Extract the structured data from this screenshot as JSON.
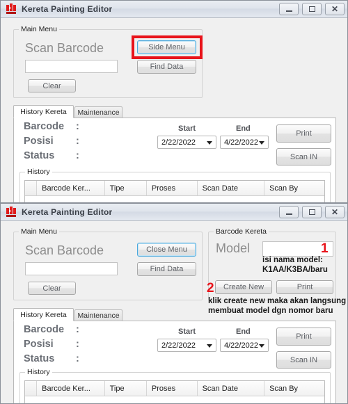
{
  "window": {
    "title": "Kereta Painting Editor",
    "app_icon": "app-icon",
    "controls": {
      "minimize": "minimize-icon",
      "maximize": "maximize-icon",
      "close": "close-icon"
    }
  },
  "main_menu": {
    "legend": "Main Menu",
    "scan_barcode_label": "Scan Barcode",
    "barcode_input_value": "",
    "barcode_input_placeholder": "",
    "clear_button": "Clear",
    "side_menu_button": "Side Menu",
    "close_menu_button": "Close Menu",
    "find_data_button": "Find Data"
  },
  "barcode_kereta": {
    "legend": "Barcode Kereta",
    "model_label": "Model",
    "model_input_value": "",
    "create_new_button": "Create New",
    "print_button": "Print"
  },
  "tabs": {
    "history_kereta": "History Kereta",
    "maintenance": "Maintenance",
    "active": "History Kereta"
  },
  "detail_fields": {
    "barcode_label": "Barcode",
    "barcode_value": "",
    "posisi_label": "Posisi",
    "posisi_value": "",
    "status_label": "Status",
    "status_value": "",
    "colon": ":"
  },
  "date_range": {
    "start_label": "Start",
    "start_value": "2/22/2022",
    "end_label": "End",
    "end_value": "4/22/2022",
    "dropdown_icon": "chevron-down-icon"
  },
  "actions": {
    "print_button": "Print",
    "scan_in_button": "Scan IN"
  },
  "history": {
    "legend": "History",
    "columns": [
      "",
      "Barcode Ker...",
      "Tipe",
      "Proses",
      "Scan Date",
      "Scan By"
    ],
    "rows": []
  },
  "annotations": {
    "marker_1": "1",
    "marker_2": "2",
    "note_model_line1": "isi nama model:",
    "note_model_line2": "K1AA/K3BA/baru",
    "note_create_line1": "klik create new maka akan langsung",
    "note_create_line2": "membuat model dgn nomor baru",
    "highlight_color": "#e8131a"
  }
}
